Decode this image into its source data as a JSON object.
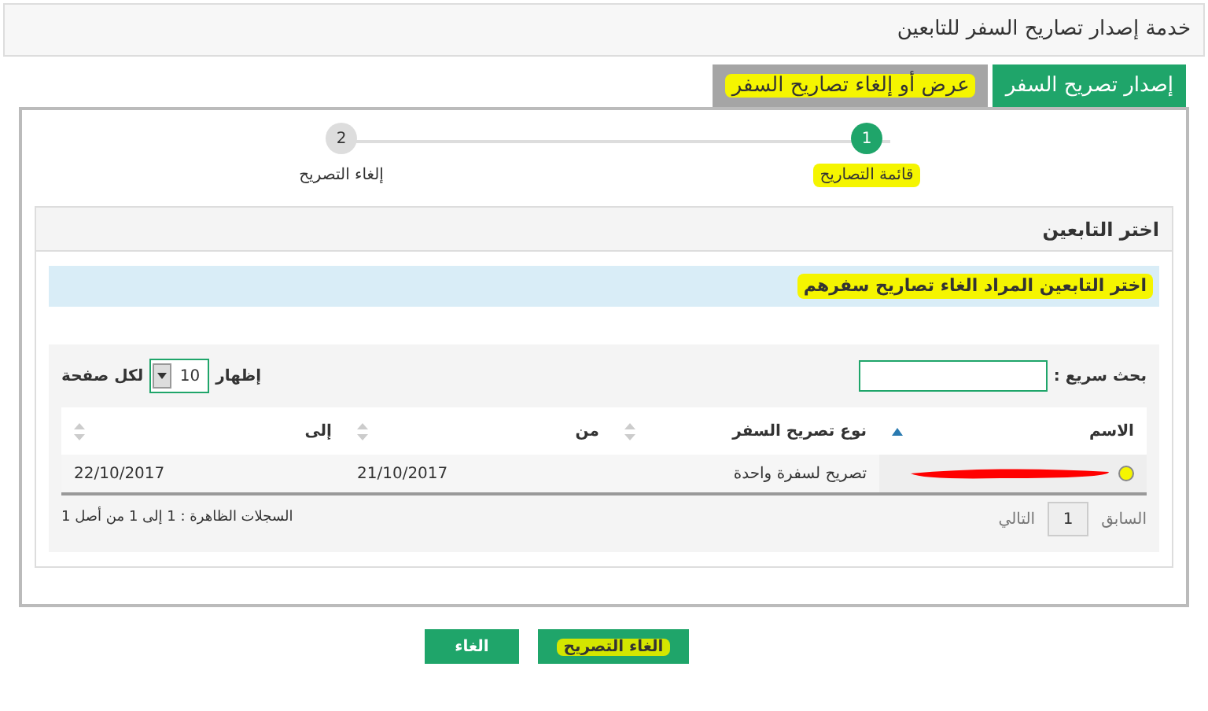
{
  "window": {
    "title": "خدمة إصدار تصاريح السفر للتابعين"
  },
  "tabs": [
    {
      "label": "إصدار تصريح السفر",
      "selected": true,
      "highlighted": false
    },
    {
      "label": "عرض أو إلغاء تصاريح السفر",
      "selected": false,
      "highlighted": true
    }
  ],
  "steps": [
    {
      "number": "1",
      "label": "قائمة التصاريح",
      "selected": true,
      "highlighted": true
    },
    {
      "number": "2",
      "label": "إلغاء التصريح",
      "selected": false,
      "highlighted": false
    }
  ],
  "panel": {
    "title": "اختر التابعين",
    "info": {
      "text": "اختر التابعين المراد الغاء تصاريح سفرهم",
      "highlighted": true
    }
  },
  "search": {
    "label": "بحث سريع :"
  },
  "page_size": {
    "prefix": "إظهار",
    "value": "10",
    "suffix": "لكل صفحة"
  },
  "table": {
    "columns": [
      {
        "label": "الاسم",
        "sorted": true
      },
      {
        "label": "نوع تصريح السفر",
        "sorted": false
      },
      {
        "label": "من",
        "sorted": false
      },
      {
        "label": "إلى",
        "sorted": false
      }
    ],
    "rows": [
      {
        "selected": false,
        "redacted": true,
        "cells": [
          "",
          "تصريح لسفرة واحدة",
          "21/10/2017",
          "22/10/2017"
        ]
      }
    ]
  },
  "pagination": {
    "previous": "السابق",
    "page": "1",
    "next": "التالي",
    "summary": "السجلات الظاهرة : 1 إلى 1 من أصل 1"
  },
  "buttons": [
    {
      "label": "الغاء التصريح",
      "highlighted": true
    },
    {
      "label": "الغاء",
      "highlighted": false
    }
  ]
}
